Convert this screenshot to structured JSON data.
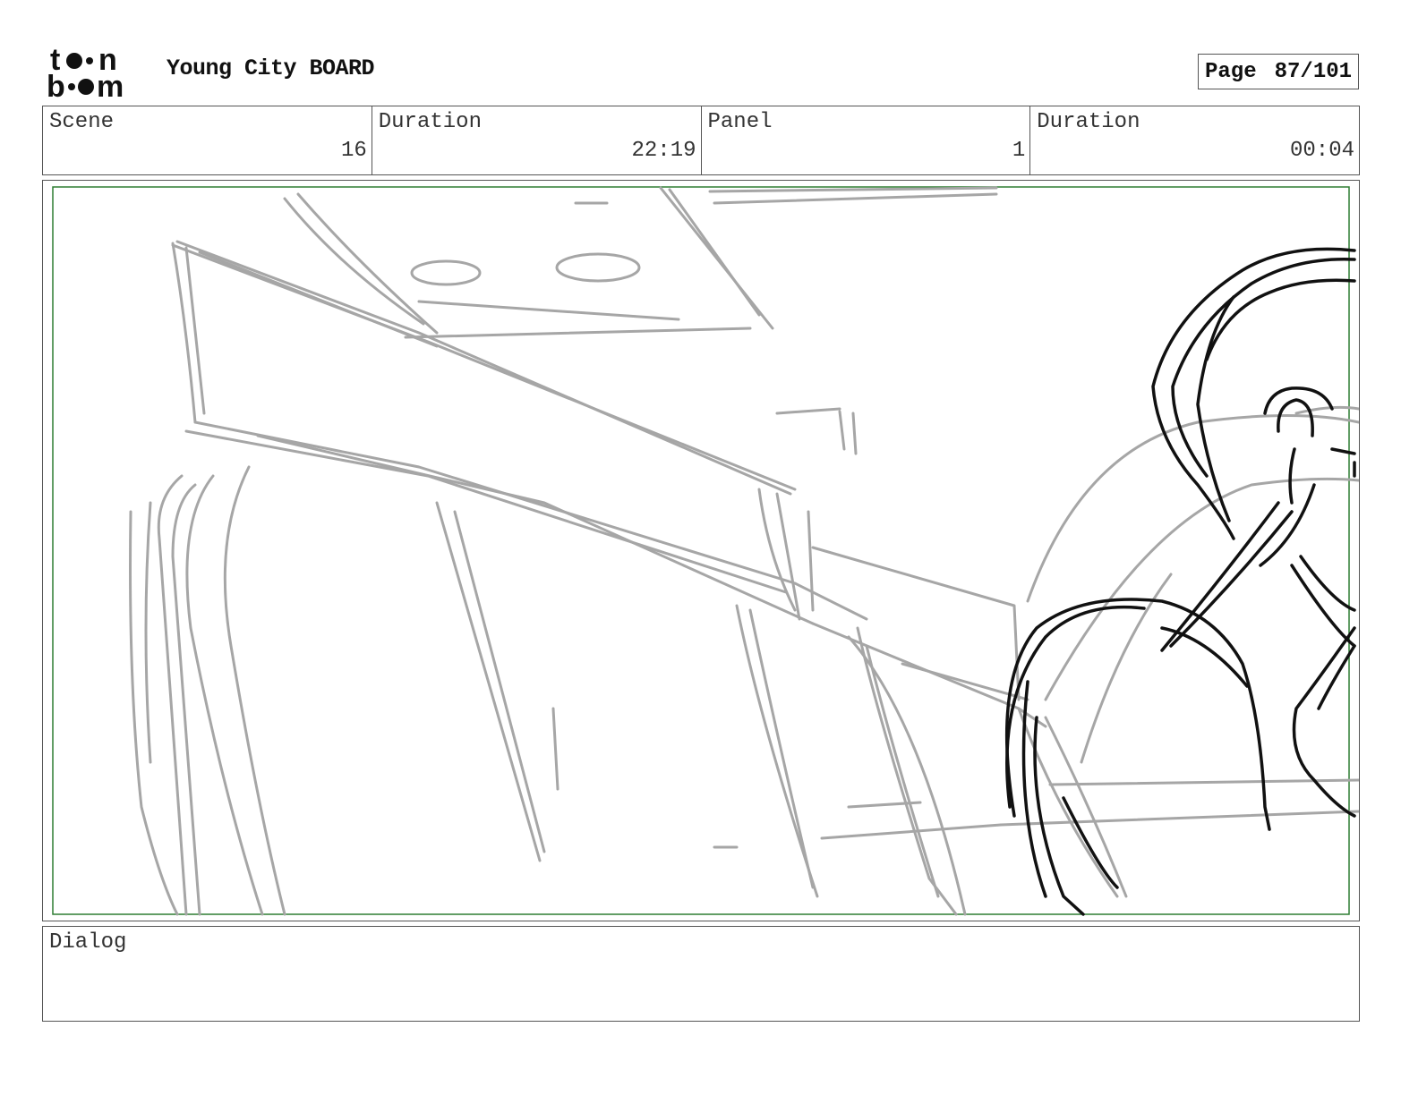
{
  "header": {
    "logo_text": "toon boom",
    "project_title": "Young City BOARD",
    "page_label": "Page",
    "page_value": "87/101"
  },
  "info": {
    "scene_label": "Scene",
    "scene_value": "16",
    "scene_duration_label": "Duration",
    "scene_duration_value": "22:19",
    "panel_label": "Panel",
    "panel_value": "1",
    "panel_duration_label": "Duration",
    "panel_duration_value": "00:04"
  },
  "dialog": {
    "label": "Dialog",
    "text": ""
  },
  "colors": {
    "safe_frame": "#2e7d32",
    "sketch_gray": "#a6a6a6",
    "sketch_black": "#111111"
  }
}
